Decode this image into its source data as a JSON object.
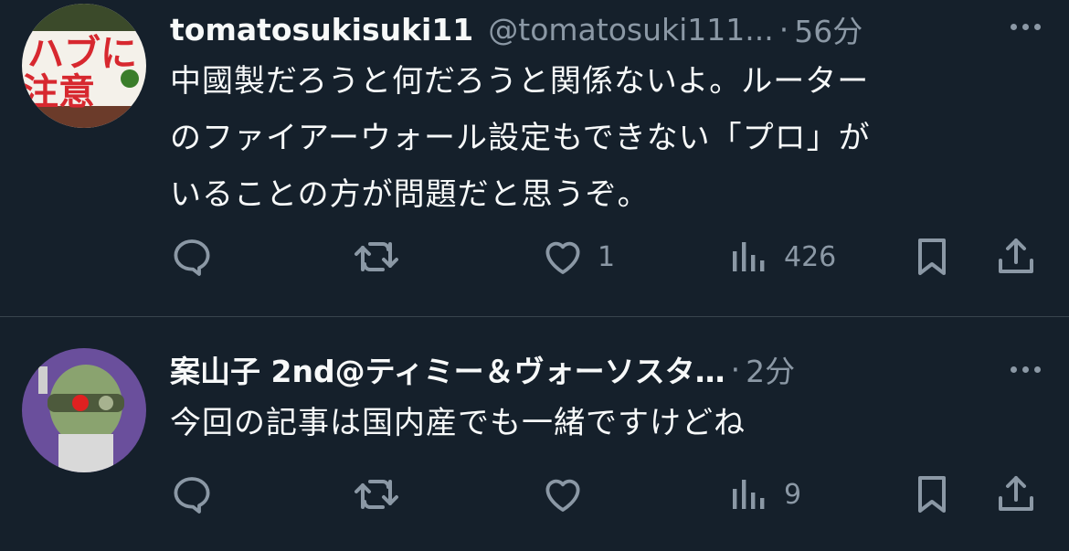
{
  "tweets": [
    {
      "name": "tomatosukisuki11",
      "handle": "@tomatosuki111...",
      "separator": "·",
      "time": "56分",
      "text_lines": [
        "中國製だろうと何だろうと関係ないよ。ルーター",
        "のファイアーウォール設定もできない「プロ」が",
        "いることの方が問題だと思うぞ。"
      ],
      "avatar_text": [
        "ハブに",
        "注意"
      ],
      "avatar_colors": {
        "bg": "#ffffff",
        "text": "#d7282f",
        "accent": "#3a7d2a"
      },
      "likes": "1",
      "views": "426",
      "icons": [
        "reply-icon",
        "retweet-icon",
        "like-icon",
        "views-icon",
        "bookmark-icon",
        "share-icon",
        "more-icon"
      ]
    },
    {
      "name": "案山子 2nd@ティミー＆ヴォーソスタ…",
      "separator": "·",
      "time": "2分",
      "text_lines": [
        "今回の記事は国内産でも一緒ですけどね"
      ],
      "likes": "",
      "views": "9",
      "avatar_colors": {
        "bg": "#6a4f9c",
        "face": "#7fa06a",
        "eye": "#e02020"
      },
      "icons": [
        "reply-icon",
        "retweet-icon",
        "like-icon",
        "views-icon",
        "bookmark-icon",
        "share-icon",
        "more-icon"
      ]
    }
  ],
  "colors": {
    "background": "#15202b",
    "text": "#f7f9f9",
    "secondary": "#8b98a5",
    "divider": "#38444d"
  }
}
